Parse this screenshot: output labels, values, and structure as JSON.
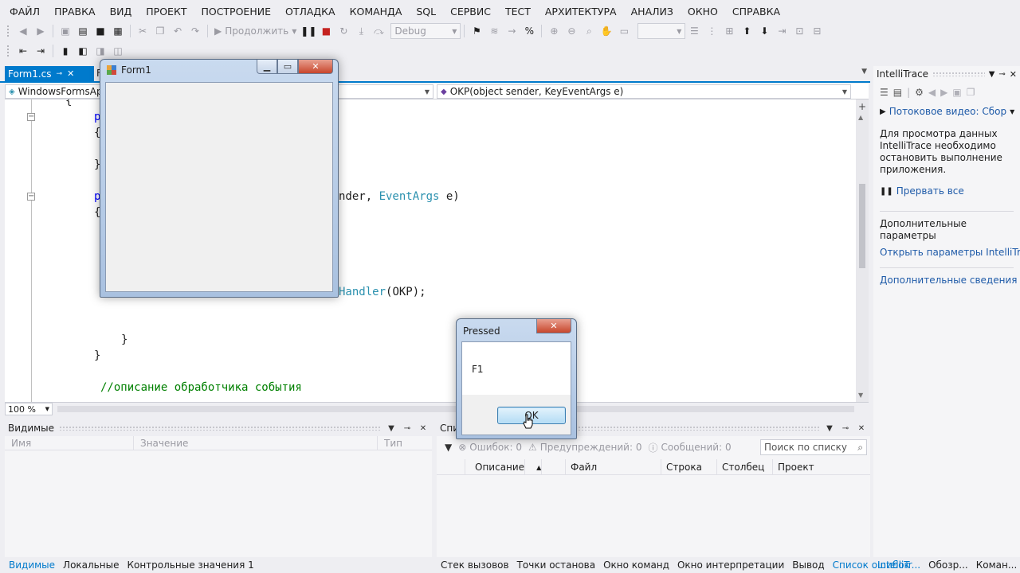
{
  "menu": [
    "ФАЙЛ",
    "ПРАВКА",
    "ВИД",
    "ПРОЕКТ",
    "ПОСТРОЕНИЕ",
    "ОТЛАДКА",
    "КОМАНДА",
    "SQL",
    "СЕРВИС",
    "ТЕСТ",
    "АРХИТЕКТУРА",
    "АНАЛИЗ",
    "ОКНО",
    "СПРАВКА"
  ],
  "toolbar": {
    "continue_label": "Продолжить",
    "config_value": "Debug"
  },
  "doc_tab": {
    "label": "Form1.cs",
    "second_tab_partial": "F"
  },
  "navbar": {
    "left_combo": "WindowsFormsAp",
    "right_combo": "OKP(object sender, KeyEventArgs e)"
  },
  "code": {
    "line1": "{",
    "line2_frag": "p",
    "line3_frag": "{",
    "line4_frag": "}",
    "line5_frag": "p",
    "line5_tail_a": "nder, ",
    "line5_tail_type": "EventArgs",
    "line5_tail_b": " e)",
    "line6_frag": "{",
    "line7_type": "Handler",
    "line7_tail": "(OKP);",
    "line8": "}",
    "line9": "}",
    "comment": "//описание обработчика события"
  },
  "zoom": "100 %",
  "locals": {
    "title": "Видимые",
    "col_name": "Имя",
    "col_value": "Значение",
    "col_type": "Тип"
  },
  "errors": {
    "title_partial": "Спис",
    "errors_count": "Ошибок: 0",
    "warnings_count": "Предупреждений: 0",
    "messages_count": "Сообщений: 0",
    "search_placeholder": "Поиск по списку",
    "col_desc": "Описание",
    "col_file": "Файл",
    "col_line": "Строка",
    "col_column": "Столбец",
    "col_project": "Проект"
  },
  "bottom_tabs_left": [
    "Видимые",
    "Локальные",
    "Контрольные значения 1"
  ],
  "bottom_tabs_mid": [
    "Стек вызовов",
    "Точки останова",
    "Окно команд",
    "Окно интерпретации",
    "Вывод",
    "Список ошибок"
  ],
  "bottom_tabs_right": [
    "IntelliTr...",
    "Обозр...",
    "Коман..."
  ],
  "intellitrace": {
    "title": "IntelliTrace",
    "video": "Потоковое видео: Сбор",
    "info": "Для просмотра данных IntelliTrace необходимо остановить выполнение приложения.",
    "break_all": "Прервать все",
    "more_params": "Дополнительные параметры",
    "open_params": "Открыть параметры IntelliTra",
    "more_info": "Дополнительные сведения о"
  },
  "form1": {
    "title": "Form1"
  },
  "msgbox": {
    "title": "Pressed",
    "text": "F1",
    "ok": "OK"
  },
  "colors": {
    "accent": "#007acc",
    "close_button": "#c8462c",
    "keyword": "#0000ff",
    "type": "#2b91af",
    "comment": "#008000"
  }
}
